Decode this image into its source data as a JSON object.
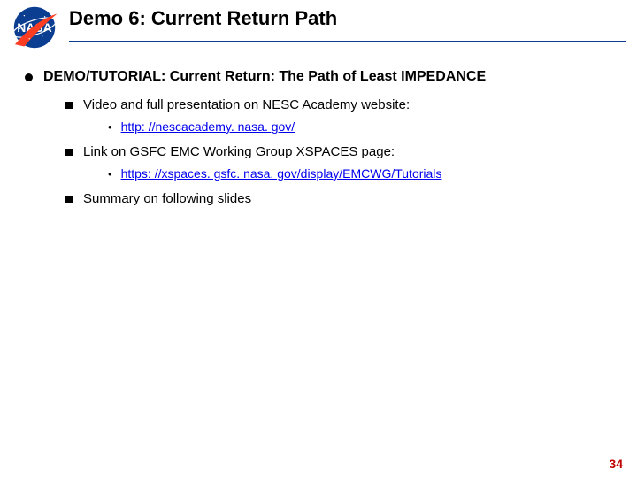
{
  "header": {
    "title": "Demo 6:  Current Return Path",
    "logo_name": "nasa-meatball-logo"
  },
  "content": {
    "l1": "DEMO/TUTORIAL:  Current Return:  The Path of Least IMPEDANCE",
    "items": [
      {
        "text": "Video and full presentation on NESC Academy website:",
        "link": "http: //nescacademy. nasa. gov/"
      },
      {
        "text": "Link on GSFC EMC Working Group XSPACES page:",
        "link": "https: //xspaces. gsfc. nasa. gov/display/EMCWG/Tutorials"
      },
      {
        "text": "Summary on following slides",
        "link": null
      }
    ]
  },
  "page_number": "34"
}
